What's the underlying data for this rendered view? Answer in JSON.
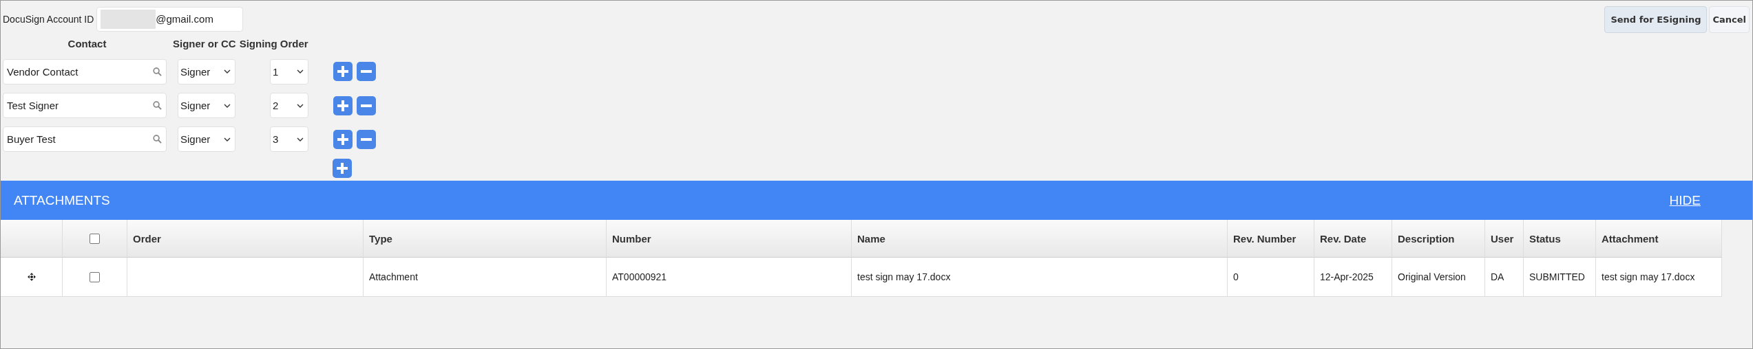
{
  "account": {
    "label": "DocuSign Account ID",
    "value": "@gmail.com"
  },
  "buttons": [
    {
      "label": "Send for ESigning",
      "kind": "primary"
    },
    {
      "label": "Cancel",
      "kind": "secondary"
    }
  ],
  "signer_headers": [
    "Contact",
    "Signer or CC",
    "Signing Order"
  ],
  "signers": [
    {
      "contact": "Vendor Contact",
      "role": "Signer",
      "order": "1"
    },
    {
      "contact": "Test Signer",
      "role": "Signer",
      "order": "2"
    },
    {
      "contact": "Buyer Test",
      "role": "Signer",
      "order": "3"
    }
  ],
  "attachments": {
    "title": "ATTACHMENTS",
    "hide_link": "HIDE",
    "columns": [
      "Order",
      "Type",
      "Number",
      "Name",
      "Rev. Number",
      "Rev. Date",
      "Description",
      "User",
      "Status",
      "Attachment"
    ],
    "header_checked": false,
    "rows": [
      {
        "checked": false,
        "cells": [
          "",
          "Attachment",
          "AT00000921",
          "test sign may 17.docx",
          "0",
          "12-Apr-2025",
          "Original Version",
          "DA",
          "SUBMITTED",
          "test sign may 17.docx"
        ]
      }
    ]
  }
}
